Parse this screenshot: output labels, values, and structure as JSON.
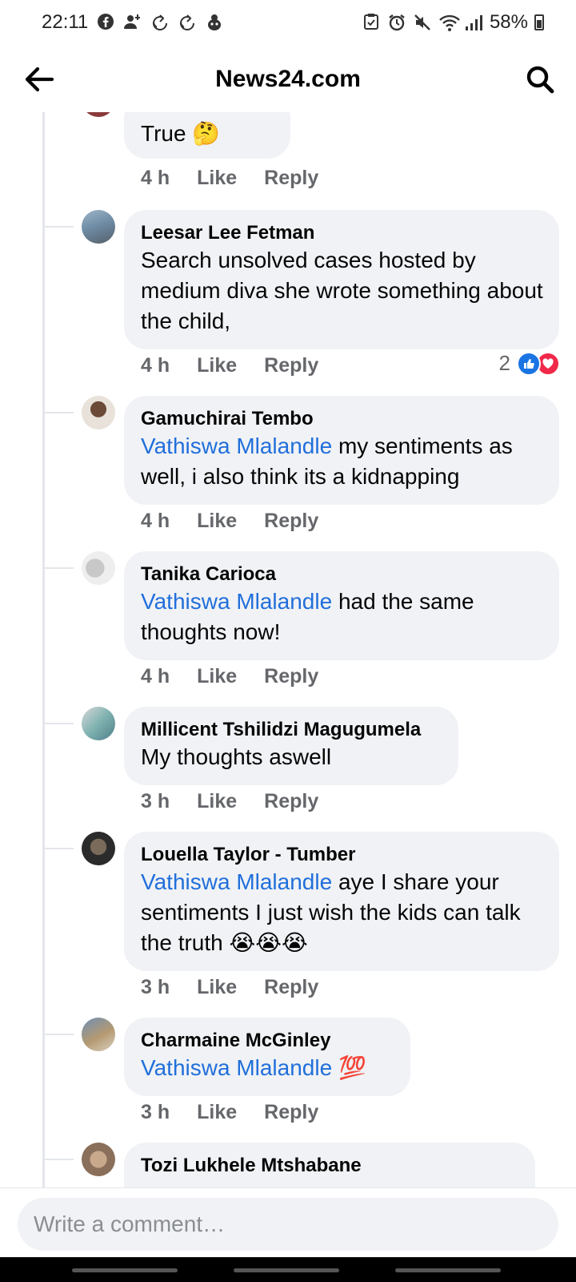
{
  "status_bar": {
    "time": "22:11",
    "battery": "58%",
    "left_icons": [
      "facebook-icon",
      "user-notify-icon",
      "sync-icon",
      "sync-icon",
      "alien-icon"
    ],
    "right_icons": [
      "save-icon",
      "alarm-icon",
      "mute-icon",
      "wifi-icon",
      "signal-icon",
      "battery-icon"
    ]
  },
  "header": {
    "title": "News24.com",
    "back_icon": "arrow-left-icon",
    "search_icon": "search-icon"
  },
  "comments": [
    {
      "author": "",
      "mention": "",
      "text": "True 🤔",
      "time": "4 h",
      "like": "Like",
      "reply": "Reply"
    },
    {
      "author": "Leesar Lee Fetman",
      "mention": "",
      "text": "Search unsolved cases hosted by medium diva she wrote something about the child,",
      "time": "4 h",
      "like": "Like",
      "reply": "Reply",
      "reactions": {
        "count": "2",
        "types": [
          "like",
          "love"
        ]
      }
    },
    {
      "author": "Gamuchirai Tembo",
      "mention": "Vathiswa Mlalandle",
      "text": " my sentiments as well, i also think its a kidnapping",
      "time": "4 h",
      "like": "Like",
      "reply": "Reply"
    },
    {
      "author": "Tanika Carioca",
      "mention": "Vathiswa Mlalandle",
      "text": " had the same thoughts  now!",
      "time": "4 h",
      "like": "Like",
      "reply": "Reply"
    },
    {
      "author": "Millicent Tshilidzi Magugumela",
      "mention": "",
      "text": "My thoughts aswell",
      "time": "3 h",
      "like": "Like",
      "reply": "Reply"
    },
    {
      "author": "Louella Taylor - Tumber",
      "mention": "Vathiswa Mlalandle",
      "text": " aye I share your sentiments I just wish the kids can talk the truth  😭😭😭",
      "time": "3 h",
      "like": "Like",
      "reply": "Reply"
    },
    {
      "author": "Charmaine McGinley",
      "mention": "Vathiswa Mlalandle",
      "text": " 💯",
      "time": "3 h",
      "like": "Like",
      "reply": "Reply"
    },
    {
      "author": "Tozi Lukhele Mtshabane",
      "mention": "",
      "text": "",
      "time": "",
      "like": "",
      "reply": ""
    }
  ],
  "composer": {
    "placeholder": "Write a comment…"
  },
  "colors": {
    "accent": "#216fdb",
    "bubble": "#f0f2f5",
    "like": "#1b74e4",
    "love": "#f02849",
    "muted": "#65676b"
  }
}
